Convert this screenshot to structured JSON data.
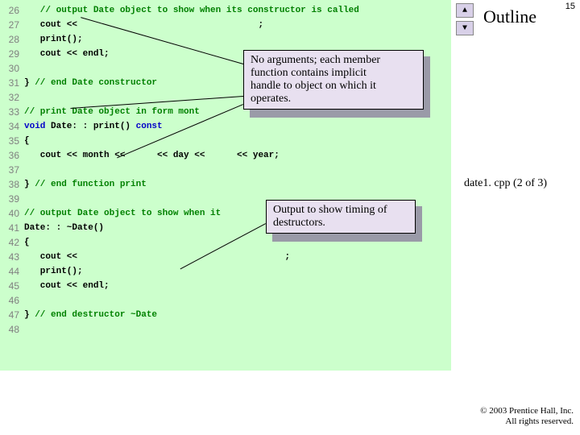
{
  "slide_number": "15",
  "outline_label": "Outline",
  "file_label": "date1. cpp (2 of 3)",
  "copyright_line1": "© 2003 Prentice Hall, Inc.",
  "copyright_line2": "All rights reserved.",
  "callout1_line1": "No arguments; each member",
  "callout1_line2": "function contains implicit",
  "callout1_line3": "handle to object on which it",
  "callout1_line4": "operates.",
  "callout2_line1": "Output to show timing of",
  "callout2_line2": "destructors.",
  "lines": {
    "26": {
      "n": "26",
      "comment": "   // output Date object to show when its constructor is called"
    },
    "27": {
      "n": "27",
      "pre": "   cout << ",
      "post": "                                 ;"
    },
    "28": {
      "n": "28",
      "text": "   print();"
    },
    "29": {
      "n": "29",
      "text": "   cout << endl;"
    },
    "30": {
      "n": "30",
      "text": ""
    },
    "31": {
      "n": "31",
      "text": "} ",
      "comment": "// end Date constructor"
    },
    "32": {
      "n": "32",
      "text": ""
    },
    "33": {
      "n": "33",
      "comment": "// print Date object in form mont"
    },
    "34_kw": "void",
    "34_mid": " Date: : print() ",
    "34_kw2": "const",
    "34": {
      "n": "34"
    },
    "35": {
      "n": "35",
      "text": "{"
    },
    "36": {
      "n": "36",
      "text": "   cout << month <<      << day <<      << year;"
    },
    "37": {
      "n": "37",
      "text": ""
    },
    "38": {
      "n": "38",
      "text": "} ",
      "comment": "// end function print"
    },
    "39": {
      "n": "39",
      "text": ""
    },
    "40": {
      "n": "40",
      "comment": "// output Date object to show when it"
    },
    "41": {
      "n": "41",
      "text": "Date: : ~Date()"
    },
    "42": {
      "n": "42",
      "text": "{"
    },
    "43": {
      "n": "43",
      "text": "   cout <<                                       ;"
    },
    "44": {
      "n": "44",
      "text": "   print();"
    },
    "45": {
      "n": "45",
      "text": "   cout << endl;"
    },
    "46": {
      "n": "46",
      "text": ""
    },
    "47": {
      "n": "47",
      "text": "} ",
      "comment": "// end destructor ~Date"
    },
    "48": {
      "n": "48",
      "text": ""
    }
  }
}
